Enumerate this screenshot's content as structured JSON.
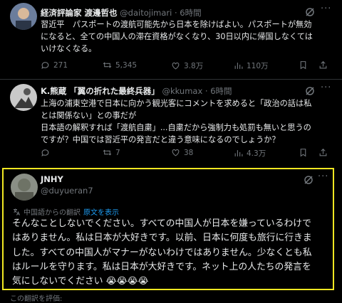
{
  "tweets": [
    {
      "name": "経済評論家 渡邊哲也",
      "handle": "@daitojimari",
      "time": "· 6時間",
      "body": [
        "習近平　パスポートの渡航可能先から日本を除けばよい。パスポートが無効",
        "になると、全ての中国人の滞在資格がなくなり、30日以内に帰国しなくては",
        "いけなくなる。"
      ],
      "replies": "271",
      "retweets": "5,345",
      "likes": "3.8万",
      "views": "110万"
    },
    {
      "name": "K.熊蔵 「翼の折れた最終兵器」",
      "handle": "@kkumax",
      "time": "· 6時間",
      "body": [
        "上海の浦東空港で日本に向かう観光客にコメントを求めると「政治の話は私",
        "とは関係ない」との事だが",
        "日本語の解釈すれば「渡航自粛」...自粛だから強制力も処罰も無いと思うの",
        "ですが？中国では習近平の発言だと違う意味になるのでしょうか？"
      ],
      "replies": "",
      "retweets": "7",
      "likes": "38",
      "views": "4.3万"
    },
    {
      "name": "JNHY",
      "handle": "@duyueran7",
      "translation_label": "中国語からの翻訳",
      "translation_link": "原文を表示",
      "body": [
        "そんなことしないでください。すべての中国人が日本を嫌っているわけで",
        "はありません。私は日本が大好きです。以前、日本に何度も旅行に行きま",
        "した。すべての中国人がマナーがないわけではありません。少なくとも私",
        "はルールを守ります。私は日本が大好きです。ネット上の人たちの発言を",
        "気にしないでください 😭😭😭😭"
      ]
    }
  ],
  "footer": "この翻訳を評価:",
  "colors": {
    "highlight": "#f0e722",
    "link": "#1d9bf0",
    "muted": "#71767b"
  },
  "icons": [
    "grok-icon",
    "more-icon",
    "reply-icon",
    "retweet-icon",
    "like-icon",
    "views-icon",
    "bookmark-icon",
    "share-icon",
    "translate-icon"
  ]
}
